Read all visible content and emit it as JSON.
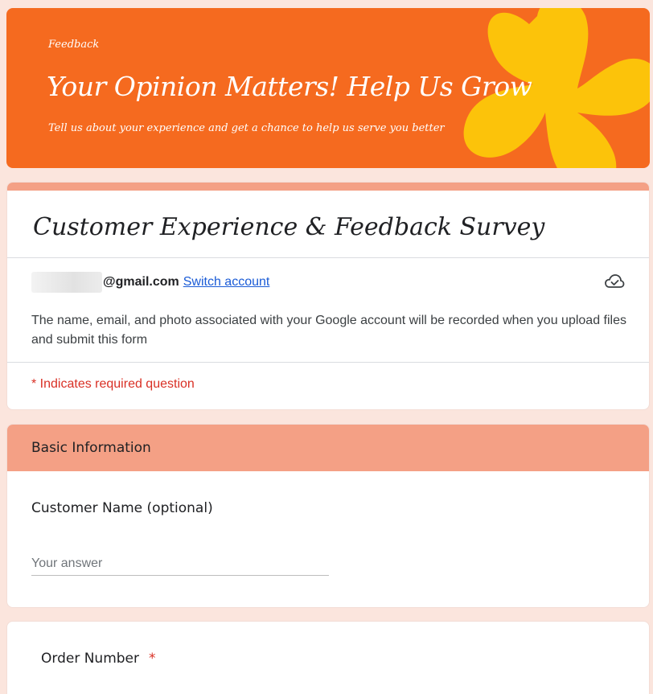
{
  "banner": {
    "small_label": "Feedback",
    "title": "Your Opinion Matters! Help Us Grow",
    "subtitle": "Tell us about your experience and get a chance to help us serve you better",
    "bg_color": "#f56a1f",
    "accent_color": "#fcc30a"
  },
  "form": {
    "title": "Customer Experience & Feedback Survey",
    "account_email": "@gmail.com",
    "switch_account_label": "Switch account",
    "cloud_icon": "cloud-check-icon",
    "notice": "The name, email, and photo associated with your Google account will be recorded when you upload files and submit this form",
    "required_note": "* Indicates required question"
  },
  "section": {
    "header": "Basic Information",
    "header_color": "#f4a085",
    "question": "Customer Name (optional)",
    "answer_placeholder": "Your answer"
  },
  "next_question": {
    "label": "Order Number",
    "required_marker": "*"
  }
}
